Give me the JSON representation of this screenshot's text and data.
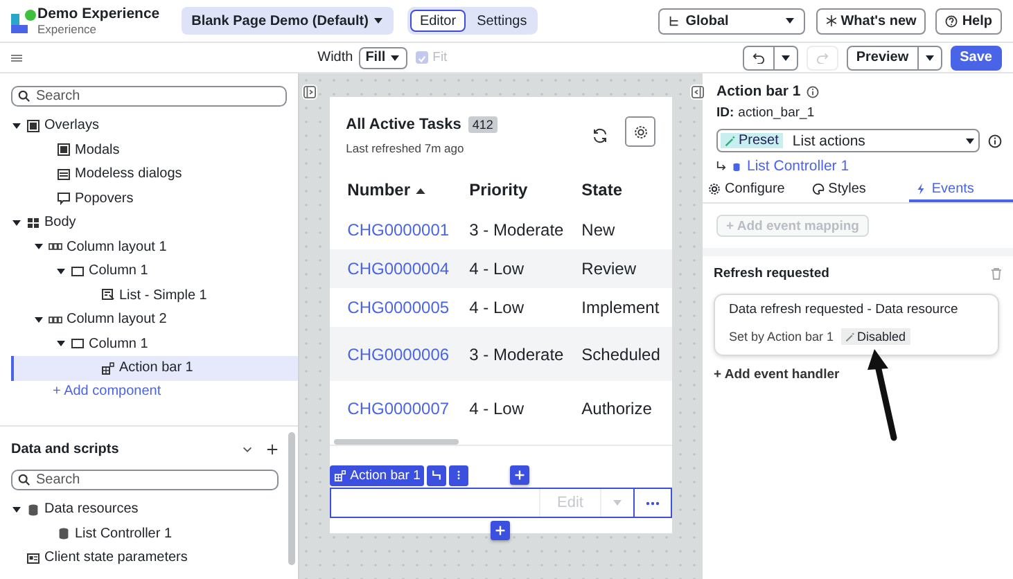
{
  "header": {
    "app_name": "Demo Experience",
    "app_subtitle": "Experience",
    "page_select": "Blank Page Demo (Default)",
    "modes": [
      {
        "label": "Editor",
        "selected": true
      },
      {
        "label": "Settings",
        "selected": false
      }
    ],
    "scope_select": "Global",
    "whats_new": "What's new",
    "help": "Help"
  },
  "toolbar": {
    "width_label": "Width",
    "width_select": "Fill",
    "fit": {
      "label": "Fit",
      "checked": true,
      "disabled": true
    },
    "redo_disabled": true,
    "preview": "Preview",
    "save": "Save"
  },
  "left_panel": {
    "search": {
      "placeholder": "Search"
    },
    "tree": [
      {
        "label": "Overlays",
        "kind": "overlays",
        "expanded": true,
        "selected": false,
        "children": [
          {
            "label": "Modals",
            "kind": "modal",
            "selected": false
          },
          {
            "label": "Modeless dialogs",
            "kind": "dialog",
            "selected": false
          },
          {
            "label": "Popovers",
            "kind": "popover",
            "selected": false
          }
        ]
      },
      {
        "label": "Body",
        "kind": "body",
        "expanded": true,
        "selected": false,
        "children": [
          {
            "label": "Column layout 1",
            "kind": "layout",
            "expanded": true,
            "selected": false,
            "children": [
              {
                "label": "Column 1",
                "kind": "column",
                "expanded": true,
                "selected": false,
                "children": [
                  {
                    "label": "List - Simple 1",
                    "kind": "list",
                    "selected": false
                  }
                ]
              }
            ]
          },
          {
            "label": "Column layout 2",
            "kind": "layout",
            "expanded": true,
            "selected": false,
            "children": [
              {
                "label": "Column 1",
                "kind": "column",
                "expanded": true,
                "selected": false,
                "children": [
                  {
                    "label": "Action bar 1",
                    "kind": "actionbar",
                    "selected": true
                  }
                ]
              }
            ]
          }
        ]
      }
    ],
    "add_component": "+ Add component",
    "data_section": {
      "title": "Data and scripts",
      "search": {
        "placeholder": "Search"
      },
      "tree": [
        {
          "label": "Data resources",
          "kind": "database",
          "expanded": true,
          "selected": false,
          "children": [
            {
              "label": "List Controller 1",
              "kind": "database",
              "selected": false
            }
          ]
        },
        {
          "label": "Client state parameters",
          "kind": "params",
          "selected": false
        }
      ]
    }
  },
  "canvas": {
    "list": {
      "title": "All Active Tasks",
      "count": "412",
      "subtitle": "Last refreshed 7m ago",
      "columns": [
        {
          "label": "Number",
          "sorted": true
        },
        {
          "label": "Priority",
          "sorted": false
        },
        {
          "label": "State",
          "sorted": false
        }
      ],
      "rows": [
        {
          "number": "CHG0000001",
          "priority": "3 - Moderate",
          "state": "New",
          "highlighted": false
        },
        {
          "number": "CHG0000004",
          "priority": "4 - Low",
          "state": "Review",
          "highlighted": true
        },
        {
          "number": "CHG0000005",
          "priority": "4 - Low",
          "state": "Implement",
          "highlighted": false
        },
        {
          "number": "CHG0000006",
          "priority": "3 - Moderate",
          "state": "Scheduled",
          "highlighted": true,
          "tall": true
        },
        {
          "number": "CHG0000007",
          "priority": "4 - Low",
          "state": "Authorize",
          "highlighted": false,
          "tall": true
        }
      ]
    },
    "action_bar": {
      "label": "Action bar 1",
      "edit": "Edit"
    }
  },
  "right_panel": {
    "title": "Action bar 1",
    "id_label": "ID:",
    "id_value": "action_bar_1",
    "preset_tag": "Preset",
    "preset_value": "List actions",
    "controller": "List Controller 1",
    "tabs": [
      {
        "label": "Configure",
        "selected": false
      },
      {
        "label": "Styles",
        "selected": false
      },
      {
        "label": "Events",
        "selected": true
      }
    ],
    "add_mapping": "+ Add event mapping",
    "event_title": "Refresh requested",
    "event_card": {
      "title": "Data refresh requested - Data resource",
      "set_by": "Set by Action bar 1",
      "badge": "Disabled"
    },
    "add_handler": "+ Add event handler"
  }
}
